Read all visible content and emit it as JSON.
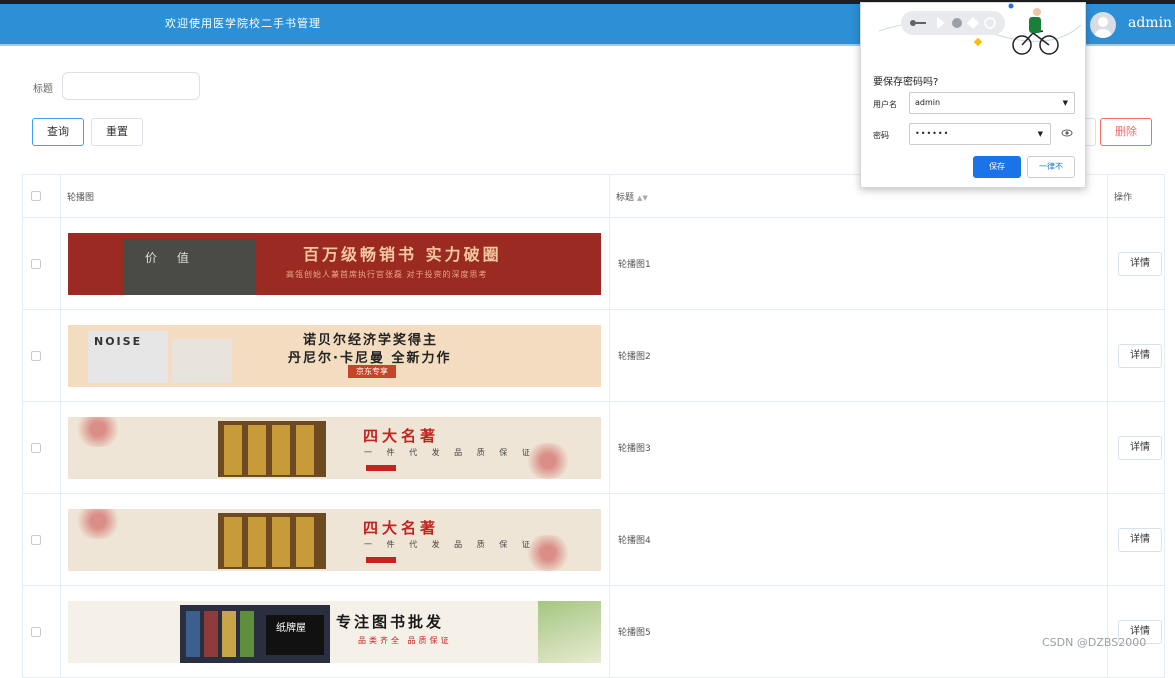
{
  "header": {
    "title": "欢迎使用医学院校二手书管理",
    "user": "admin"
  },
  "filter": {
    "label": "标题",
    "input_value": "",
    "query_label": "查询",
    "reset_label": "重置",
    "delete_label": "删除"
  },
  "table": {
    "columns": {
      "image": "轮播图",
      "title": "标题",
      "ops": "操作"
    },
    "detail_label": "详情",
    "rows": [
      {
        "title": "轮播图1"
      },
      {
        "title": "轮播图2"
      },
      {
        "title": "轮播图3"
      },
      {
        "title": "轮播图4"
      },
      {
        "title": "轮播图5"
      }
    ]
  },
  "banners": {
    "b1": {
      "book": "价 值",
      "headline": "百万级畅销书 实力破圈",
      "sub": "高瓴创始人兼首席执行官张磊 对于投资的深度思考"
    },
    "b2": {
      "cover": "NOISE",
      "line1": "诺贝尔经济学奖得主",
      "line2": "丹尼尔·卡尼曼 全新力作",
      "tag": "京东专享"
    },
    "b3": {
      "headline": "四大名著",
      "sub": "一 件 代 发 品 质 保 证"
    },
    "b5": {
      "cover": "纸牌屋",
      "headline": "专注图书批发",
      "sub": "品类齐全 品质保证"
    }
  },
  "password_popup": {
    "question": "要保存密码吗?",
    "username_label": "用户名",
    "username_value": "admin",
    "password_label": "密码",
    "password_value": "••••••",
    "save_label": "保存",
    "never_label": "一律不"
  },
  "watermark": "CSDN @DZBS2000",
  "colors": {
    "header": "#2d8fd5",
    "primary": "#409eff",
    "danger": "#f56c6c",
    "chrome_blue": "#1a73e8"
  }
}
